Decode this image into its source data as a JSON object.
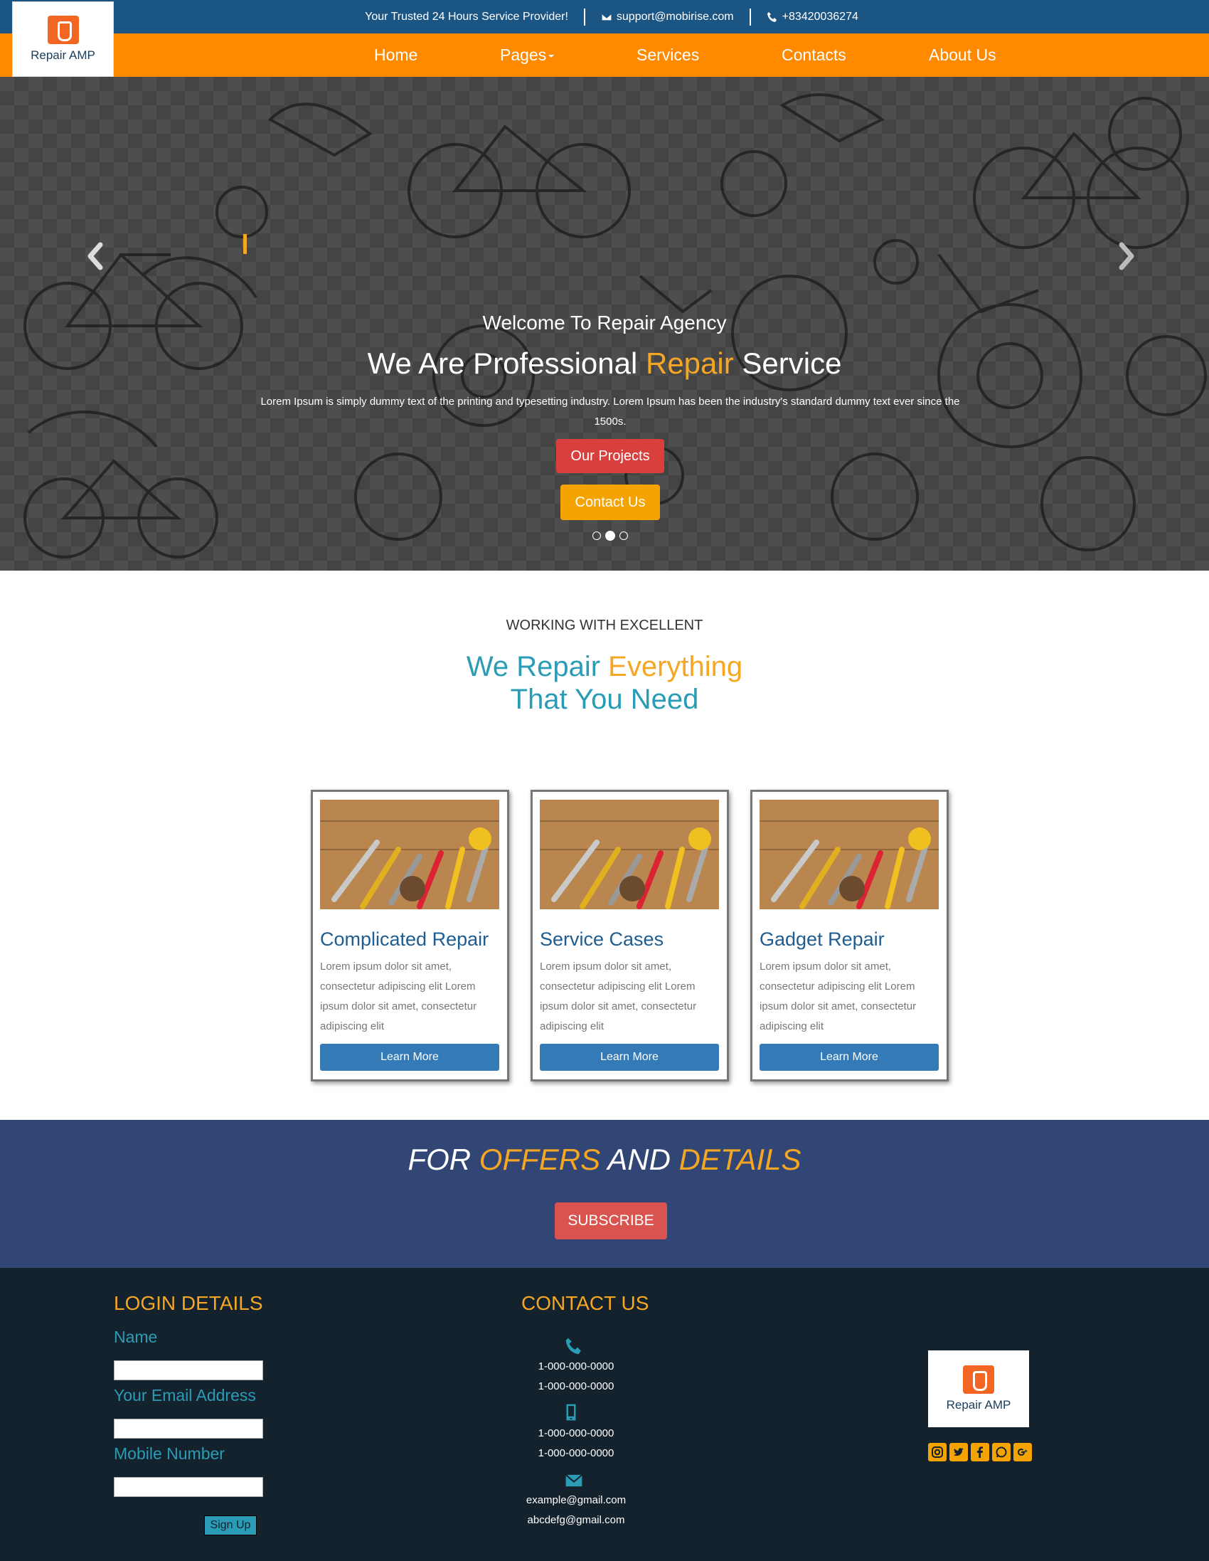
{
  "topbar": {
    "tagline": "Your Trusted 24 Hours Service Provider!",
    "email": "support@mobirise.com",
    "phone": "+83420036274"
  },
  "brand": {
    "logo_text_main": "Repair",
    "logo_text_amp": "AMP"
  },
  "nav": {
    "items": [
      "Home",
      "Pages",
      "Services",
      "Contacts",
      "About Us"
    ]
  },
  "hero": {
    "welcome": "Welcome To Repair Agency",
    "title_pre": "We Are Professional ",
    "title_highlight": "Repair",
    "title_post": " Service",
    "description": "Lorem Ipsum is simply dummy text of the printing and typesetting industry. Lorem Ipsum has been the industry's standard dummy text ever since the 1500s.",
    "btn_projects": "Our Projects",
    "btn_contact": "Contact Us",
    "slide_count": 3,
    "active_slide": 2
  },
  "intro": {
    "subtitle": "WORKING WITH EXCELLENT",
    "title_pre": "We Repair ",
    "title_highlight": "Everything",
    "title_line2": "That You Need"
  },
  "cards": [
    {
      "title": "Complicated Repair",
      "text": "Lorem ipsum dolor sit amet, consectetur adipiscing elit Lorem ipsum dolor sit amet, consectetur adipiscing elit",
      "button": "Learn More"
    },
    {
      "title": "Service Cases",
      "text": "Lorem ipsum dolor sit amet, consectetur adipiscing elit Lorem ipsum dolor sit amet, consectetur adipiscing elit",
      "button": "Learn More"
    },
    {
      "title": "Gadget Repair",
      "text": "Lorem ipsum dolor sit amet, consectetur adipiscing elit Lorem ipsum dolor sit amet, consectetur adipiscing elit",
      "button": "Learn More"
    }
  ],
  "offers": {
    "w1": "FOR ",
    "w2": "OFFERS",
    "w3": " AND ",
    "w4": "DETAILS",
    "button": "SUBSCRIBE"
  },
  "footer": {
    "login_title": "LOGIN DETAILS",
    "name_label": "Name",
    "email_label": "Your Email Address",
    "mobile_label": "Mobile Number",
    "signup_button": "Sign Up",
    "contact_title": "CONTACT US",
    "phones": [
      "1-000-000-0000",
      "1-000-000-0000"
    ],
    "mobiles": [
      "1-000-000-0000",
      "1-000-000-0000"
    ],
    "emails": [
      "example@gmail.com",
      "abcdefg@gmail.com"
    ],
    "social_icons": [
      "instagram-icon",
      "twitter-icon",
      "facebook-icon",
      "whatsapp-icon",
      "google-plus-icon"
    ]
  },
  "colors": {
    "topbar": "#1b5584",
    "nav": "#ff8a00",
    "accent": "#f5a623",
    "teal": "#2b9cb5",
    "offers_bg": "#324675",
    "footer_bg": "#14222e",
    "card_button": "#337ab7",
    "danger": "#d9534f"
  }
}
